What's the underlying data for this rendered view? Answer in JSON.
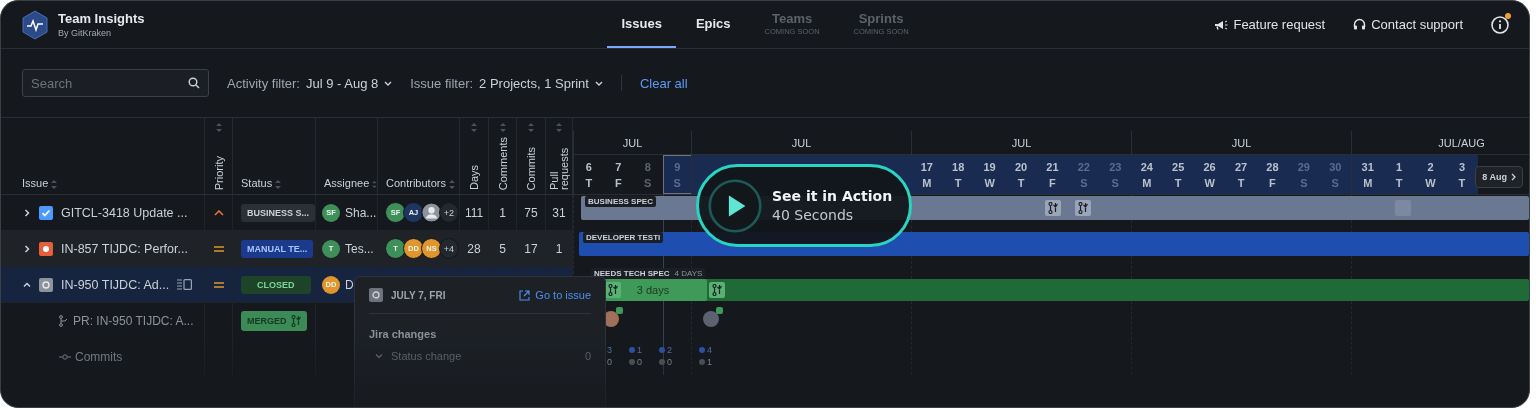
{
  "app": {
    "title": "Team Insights",
    "subtitle": "By GitKraken"
  },
  "tabs": [
    {
      "label": "Issues",
      "selected": true,
      "disabled": false
    },
    {
      "label": "Epics",
      "selected": false,
      "disabled": false
    },
    {
      "label": "Teams",
      "note": "COMING SOON",
      "selected": false,
      "disabled": true
    },
    {
      "label": "Sprints",
      "note": "COMING SOON",
      "selected": false,
      "disabled": true
    }
  ],
  "header_actions": [
    {
      "kind": "feature",
      "label": "Feature request"
    },
    {
      "kind": "support",
      "label": "Contact support"
    }
  ],
  "info": {
    "unread": true
  },
  "filters": {
    "search": {
      "placeholder": "Search"
    },
    "activity": {
      "label": "Activity filter:",
      "value": "Jul 9 - Aug 8"
    },
    "issue": {
      "label": "Issue filter:",
      "value": "2 Projects, 1 Sprint"
    },
    "clear": "Clear all"
  },
  "table": {
    "columns": [
      {
        "label": "Issue",
        "kind": "horizontal"
      },
      {
        "label": "Priority",
        "kind": "vertical"
      },
      {
        "label": "Status",
        "kind": "horizontal"
      },
      {
        "label": "Assignee",
        "kind": "horizontal"
      },
      {
        "label": "Contributors",
        "kind": "horizontal"
      },
      {
        "label": "Days",
        "kind": "vertical"
      },
      {
        "label": "Comments",
        "kind": "vertical"
      },
      {
        "label": "Commits",
        "kind": "vertical"
      },
      {
        "label": "Pull requests",
        "kind": "vertical"
      }
    ],
    "rows": [
      {
        "kind": "issue",
        "expanded": false,
        "selected": false,
        "hovered": false,
        "icon": {
          "kind": "task"
        },
        "title": "GITCL-3418 Update ...",
        "priority": {
          "kind": "high"
        },
        "status": {
          "label": "BUSINESS S...",
          "kind": "gray"
        },
        "assignee": {
          "initials": "SF",
          "color": "#3f8f5a",
          "name": "Sha..."
        },
        "contributors": [
          {
            "kind": "initials",
            "initials": "SF",
            "color": "#3f8f5a"
          },
          {
            "kind": "initials",
            "initials": "AJ",
            "color": "#1f3462"
          },
          {
            "kind": "person"
          }
        ],
        "more": "+2",
        "days": "111",
        "comments": "1",
        "commits": "75",
        "pull_requests": "31"
      },
      {
        "kind": "issue",
        "expanded": false,
        "selected": false,
        "hovered": true,
        "icon": {
          "kind": "bug"
        },
        "title": "IN-857 TIJDC: Perfor...",
        "priority": {
          "kind": "medium"
        },
        "status": {
          "label": "MANUAL TE...",
          "kind": "blue"
        },
        "assignee": {
          "initials": "T",
          "color": "#3f8f5a",
          "name": "Tes..."
        },
        "contributors": [
          {
            "kind": "initials",
            "initials": "T",
            "color": "#3f8f5a"
          },
          {
            "kind": "initials",
            "initials": "DD",
            "color": "#e0962c"
          },
          {
            "kind": "initials",
            "initials": "NS",
            "color": "#e0962c"
          }
        ],
        "more": "+4",
        "days": "28",
        "comments": "5",
        "commits": "17",
        "pull_requests": "1"
      },
      {
        "kind": "issue",
        "expanded": true,
        "selected": true,
        "hovered": false,
        "icon": {
          "kind": "other"
        },
        "panel_icon": true,
        "title": "IN-950 TIJDC: Ad...",
        "priority": {
          "kind": "medium"
        },
        "status": {
          "label": "CLOSED",
          "kind": "green"
        },
        "assignee": {
          "initials": "DD",
          "color": "#e0962c",
          "name": "D"
        }
      },
      {
        "kind": "pr",
        "title": "PR: IN-950 TIJDC: A...",
        "status": {
          "label": "MERGED",
          "kind": "merged"
        }
      },
      {
        "kind": "commits",
        "title": "Commits"
      }
    ]
  },
  "gantt": {
    "weeks": [
      {
        "month": "JUL",
        "days": [
          {
            "day": "6",
            "weekday": "T",
            "weekend": false,
            "in_range": false,
            "today": false
          },
          {
            "day": "7",
            "weekday": "F",
            "weekend": false,
            "in_range": false,
            "today": false
          },
          {
            "day": "8",
            "weekday": "S",
            "weekend": true,
            "in_range": false,
            "today": false
          },
          {
            "day": "9",
            "weekday": "S",
            "weekend": true,
            "in_range": true,
            "today": true
          }
        ]
      },
      {
        "month": "JUL",
        "in_range": true
      },
      {
        "month": "JUL",
        "days": [
          {
            "day": "17",
            "weekday": "M",
            "weekend": false,
            "in_range": true,
            "today": false
          },
          {
            "day": "18",
            "weekday": "T",
            "weekend": false,
            "in_range": true,
            "today": false
          },
          {
            "day": "19",
            "weekday": "W",
            "weekend": false,
            "in_range": true,
            "today": false
          },
          {
            "day": "20",
            "weekday": "T",
            "weekend": false,
            "in_range": true,
            "today": false
          },
          {
            "day": "21",
            "weekday": "F",
            "weekend": false,
            "in_range": true,
            "today": false
          },
          {
            "day": "22",
            "weekday": "S",
            "weekend": true,
            "in_range": true,
            "today": false
          },
          {
            "day": "23",
            "weekday": "S",
            "weekend": true,
            "in_range": true,
            "today": false
          }
        ]
      },
      {
        "month": "JUL",
        "days": [
          {
            "day": "24",
            "weekday": "M",
            "weekend": false,
            "in_range": true,
            "today": false
          },
          {
            "day": "25",
            "weekday": "T",
            "weekend": false,
            "in_range": true,
            "today": false
          },
          {
            "day": "26",
            "weekday": "W",
            "weekend": false,
            "in_range": true,
            "today": false
          },
          {
            "day": "27",
            "weekday": "T",
            "weekend": false,
            "in_range": true,
            "today": false
          },
          {
            "day": "28",
            "weekday": "F",
            "weekend": false,
            "in_range": true,
            "today": false
          },
          {
            "day": "29",
            "weekday": "S",
            "weekend": true,
            "in_range": true,
            "today": false
          },
          {
            "day": "30",
            "weekday": "S",
            "weekend": true,
            "in_range": true,
            "today": false
          }
        ]
      },
      {
        "month": "JUL/AUG",
        "days": [
          {
            "day": "31",
            "weekday": "M",
            "weekend": false,
            "in_range": true,
            "today": false
          },
          {
            "day": "1",
            "weekday": "T",
            "weekend": false,
            "in_range": true,
            "today": false
          },
          {
            "day": "2",
            "weekday": "W",
            "weekend": false,
            "in_range": true,
            "today": false
          },
          {
            "day": "3",
            "weekday": "T",
            "weekend": false,
            "in_range": true,
            "today": false
          }
        ]
      }
    ],
    "next": "8 Aug",
    "lanes": [
      {
        "kind": "bar",
        "color": "#6b7891",
        "label": "BUSINESS SPEC",
        "markers": [
          {
            "kind": "pr"
          },
          {
            "kind": "pr"
          },
          {
            "kind": "blank"
          }
        ]
      },
      {
        "kind": "bar",
        "color": "#1e4fb0",
        "label": "DEVELOPER TESTI"
      },
      {
        "kind": "bar",
        "color": "#1f6a36",
        "label": "NEEDS TECH SPEC",
        "duration": "4 DAYS",
        "segment": "3 days",
        "markers": [
          {
            "kind": "pr-open"
          },
          {
            "kind": "pr"
          }
        ]
      },
      {
        "kind": "avatars",
        "items": [
          {
            "kind": "photo"
          },
          {
            "kind": "person"
          }
        ]
      },
      {
        "kind": "commits",
        "items": [
          {
            "added": "3",
            "removed": "0"
          },
          {
            "added": "1",
            "removed": "0"
          },
          {
            "added": "2",
            "removed": "0"
          },
          {
            "added": "4",
            "removed": "1"
          }
        ]
      }
    ]
  },
  "popover": {
    "date": "JULY 7, FRI",
    "link": "Go to issue",
    "section": "Jira changes",
    "items": [
      {
        "label": "Status change",
        "count": "0",
        "expanded": false
      }
    ]
  },
  "promo": {
    "title": "See it in Action",
    "subtitle": "40 Seconds"
  }
}
